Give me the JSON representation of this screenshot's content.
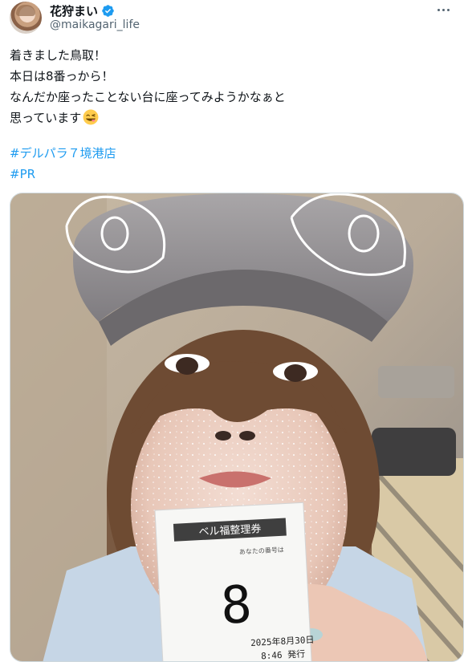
{
  "post": {
    "author": {
      "display_name": "花狩まい",
      "handle": "@maikagari_life",
      "verified": true
    },
    "text_lines": [
      "着きました鳥取！",
      "本日は8番っから！",
      "なんだか座ったことない台に座ってみようかなぁと",
      "思っています"
    ],
    "emoji": "face-savoring-food-icon",
    "hashtags": [
      "#デルパラ７境港店",
      "#PR"
    ],
    "media": {
      "ticket": {
        "header": "ベル福整理券",
        "subtext": "あなたの番号は",
        "number": "8",
        "date_line": "2025年8月30日",
        "time_line": "8:46 発行"
      }
    }
  },
  "colors": {
    "text": "#0f1419",
    "secondary": "#536471",
    "link": "#1d9bf0",
    "verified": "#1d9bf0",
    "border": "#cfd9de"
  }
}
